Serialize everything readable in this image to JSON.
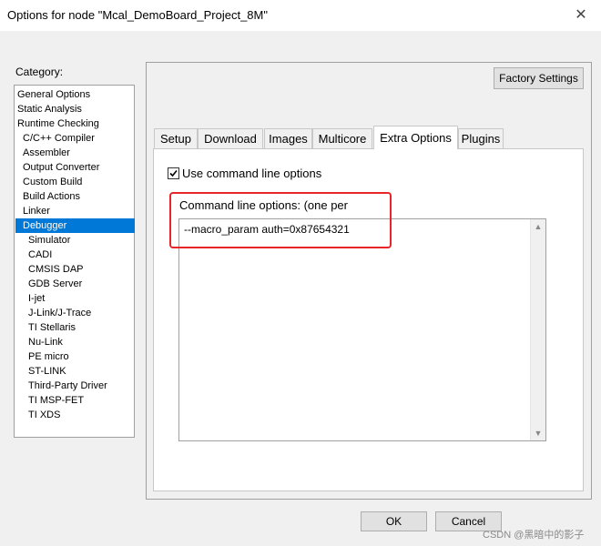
{
  "window": {
    "title": "Options for node \"Mcal_DemoBoard_Project_8M\"",
    "close_symbol": "✕"
  },
  "category": {
    "label": "Category:",
    "items": [
      {
        "label": "General Options",
        "level": 0
      },
      {
        "label": "Static Analysis",
        "level": 0
      },
      {
        "label": "Runtime Checking",
        "level": 0
      },
      {
        "label": "C/C++ Compiler",
        "level": 1
      },
      {
        "label": "Assembler",
        "level": 1
      },
      {
        "label": "Output Converter",
        "level": 1
      },
      {
        "label": "Custom Build",
        "level": 1
      },
      {
        "label": "Build Actions",
        "level": 1
      },
      {
        "label": "Linker",
        "level": 1
      },
      {
        "label": "Debugger",
        "level": 1,
        "selected": true
      },
      {
        "label": "Simulator",
        "level": 2
      },
      {
        "label": "CADI",
        "level": 2
      },
      {
        "label": "CMSIS DAP",
        "level": 2
      },
      {
        "label": "GDB Server",
        "level": 2
      },
      {
        "label": "I-jet",
        "level": 2
      },
      {
        "label": "J-Link/J-Trace",
        "level": 2
      },
      {
        "label": "TI Stellaris",
        "level": 2
      },
      {
        "label": "Nu-Link",
        "level": 2
      },
      {
        "label": "PE micro",
        "level": 2
      },
      {
        "label": "ST-LINK",
        "level": 2
      },
      {
        "label": "Third-Party Driver",
        "level": 2
      },
      {
        "label": "TI MSP-FET",
        "level": 2
      },
      {
        "label": "TI XDS",
        "level": 2
      }
    ]
  },
  "factory_settings_label": "Factory Settings",
  "tabs": [
    {
      "label": "Setup"
    },
    {
      "label": "Download"
    },
    {
      "label": "Images"
    },
    {
      "label": "Multicore"
    },
    {
      "label": "Extra Options",
      "active": true
    },
    {
      "label": "Plugins"
    }
  ],
  "extra_options": {
    "use_cmdline_label": "Use command line options",
    "use_cmdline_checked": true,
    "cmdline_label": "Command line options:  (one per",
    "cmdline_value": "--macro_param auth=0x87654321"
  },
  "buttons": {
    "ok": "OK",
    "cancel": "Cancel"
  },
  "watermark": "CSDN @黑暗中的影子",
  "colors": {
    "selection": "#0078d7",
    "highlight": "#e8262a"
  }
}
